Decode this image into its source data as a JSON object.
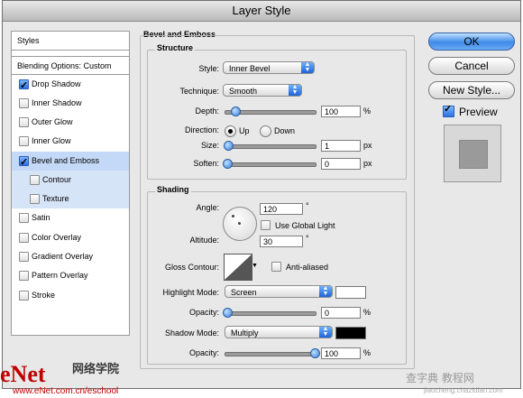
{
  "window": {
    "title": "Layer Style"
  },
  "sidebar": {
    "header": "Styles",
    "blending": "Blending Options: Custom",
    "items": [
      {
        "label": "Drop Shadow",
        "checked": true
      },
      {
        "label": "Inner Shadow",
        "checked": false
      },
      {
        "label": "Outer Glow",
        "checked": false
      },
      {
        "label": "Inner Glow",
        "checked": false
      },
      {
        "label": "Bevel and Emboss",
        "checked": true,
        "selected": true
      },
      {
        "label": "Contour",
        "checked": false,
        "sub": true
      },
      {
        "label": "Texture",
        "checked": false,
        "sub": true
      },
      {
        "label": "Satin",
        "checked": false
      },
      {
        "label": "Color Overlay",
        "checked": false
      },
      {
        "label": "Gradient Overlay",
        "checked": false
      },
      {
        "label": "Pattern Overlay",
        "checked": false
      },
      {
        "label": "Stroke",
        "checked": false
      }
    ]
  },
  "bevel": {
    "title": "Bevel and Emboss",
    "structure": {
      "title": "Structure",
      "style_label": "Style:",
      "style_value": "Inner Bevel",
      "technique_label": "Technique:",
      "technique_value": "Smooth",
      "depth_label": "Depth:",
      "depth_value": "100",
      "depth_unit": "%",
      "direction_label": "Direction:",
      "dir_up": "Up",
      "dir_down": "Down",
      "size_label": "Size:",
      "size_value": "1",
      "size_unit": "px",
      "soften_label": "Soften:",
      "soften_value": "0",
      "soften_unit": "px"
    },
    "shading": {
      "title": "Shading",
      "angle_label": "Angle:",
      "angle_value": "120",
      "angle_unit": "°",
      "global_light": "Use Global Light",
      "altitude_label": "Altitude:",
      "altitude_value": "30",
      "altitude_unit": "°",
      "gloss_label": "Gloss Contour:",
      "anti_aliased": "Anti-aliased",
      "highlight_label": "Highlight Mode:",
      "highlight_value": "Screen",
      "hl_opacity_label": "Opacity:",
      "hl_opacity_value": "0",
      "hl_opacity_unit": "%",
      "shadow_label": "Shadow Mode:",
      "shadow_value": "Multiply",
      "sh_opacity_label": "Opacity:",
      "sh_opacity_value": "100",
      "sh_opacity_unit": "%",
      "highlight_color": "#ffffff",
      "shadow_color": "#000000"
    }
  },
  "buttons": {
    "ok": "OK",
    "cancel": "Cancel",
    "new_style": "New Style...",
    "preview": "Preview"
  },
  "watermark": {
    "left": "eNet",
    "left_cn": "网络学院",
    "url": "www.eNet.com.cn/eschool",
    "right": "查字典 教程网",
    "right_url": "jiaocheng.chazidian.com"
  }
}
